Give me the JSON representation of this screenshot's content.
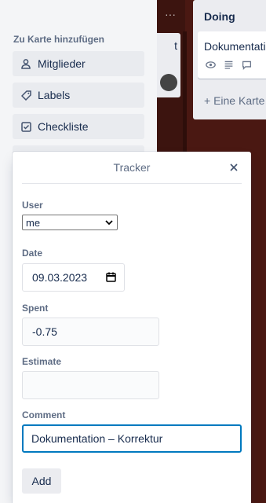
{
  "board": {
    "list_left": {
      "menu_label": "···",
      "card_title_fragment": "t"
    },
    "list_doing": {
      "title": "Doing",
      "card_title": "Dokumentation",
      "add_card_label": "+ Eine Karte"
    }
  },
  "sidebar": {
    "heading": "Zu Karte hinzufügen",
    "items": [
      {
        "label": "Mitglieder",
        "icon": "person-icon"
      },
      {
        "label": "Labels",
        "icon": "tag-icon"
      },
      {
        "label": "Checkliste",
        "icon": "checkbox-icon"
      }
    ]
  },
  "tracker": {
    "title": "Tracker",
    "user_label": "User",
    "user_value": "me",
    "date_label": "Date",
    "date_value": "09.03.2023",
    "spent_label": "Spent",
    "spent_value": "-0.75",
    "estimate_label": "Estimate",
    "estimate_value": "",
    "comment_label": "Comment",
    "comment_value": "Dokumentation – Korrektur",
    "add_label": "Add"
  },
  "colors": {
    "board_bg": "#4a1812",
    "sidebar_bg": "#f4f5f7",
    "focus_border": "#0079bf"
  }
}
